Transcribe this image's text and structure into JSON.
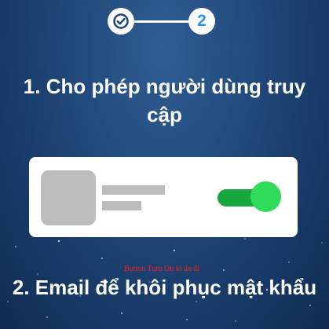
{
  "stepper": {
    "step1": {
      "state": "completed",
      "icon": "check-icon"
    },
    "step2": {
      "label": "2",
      "state": "active"
    }
  },
  "instructions": {
    "step1_title": "1. Cho phép người dùng truy cập",
    "step2_title": "2. Email để khôi phục mật khẩu"
  },
  "illustration": {
    "toggle_state": "on",
    "hint_text": "Button Turn On ki ấn đi"
  },
  "colors": {
    "accent": "#2196f3",
    "toggle_track": "#1aa63f",
    "toggle_knob": "#2fdc5a",
    "hint": "#ff1a1a"
  }
}
